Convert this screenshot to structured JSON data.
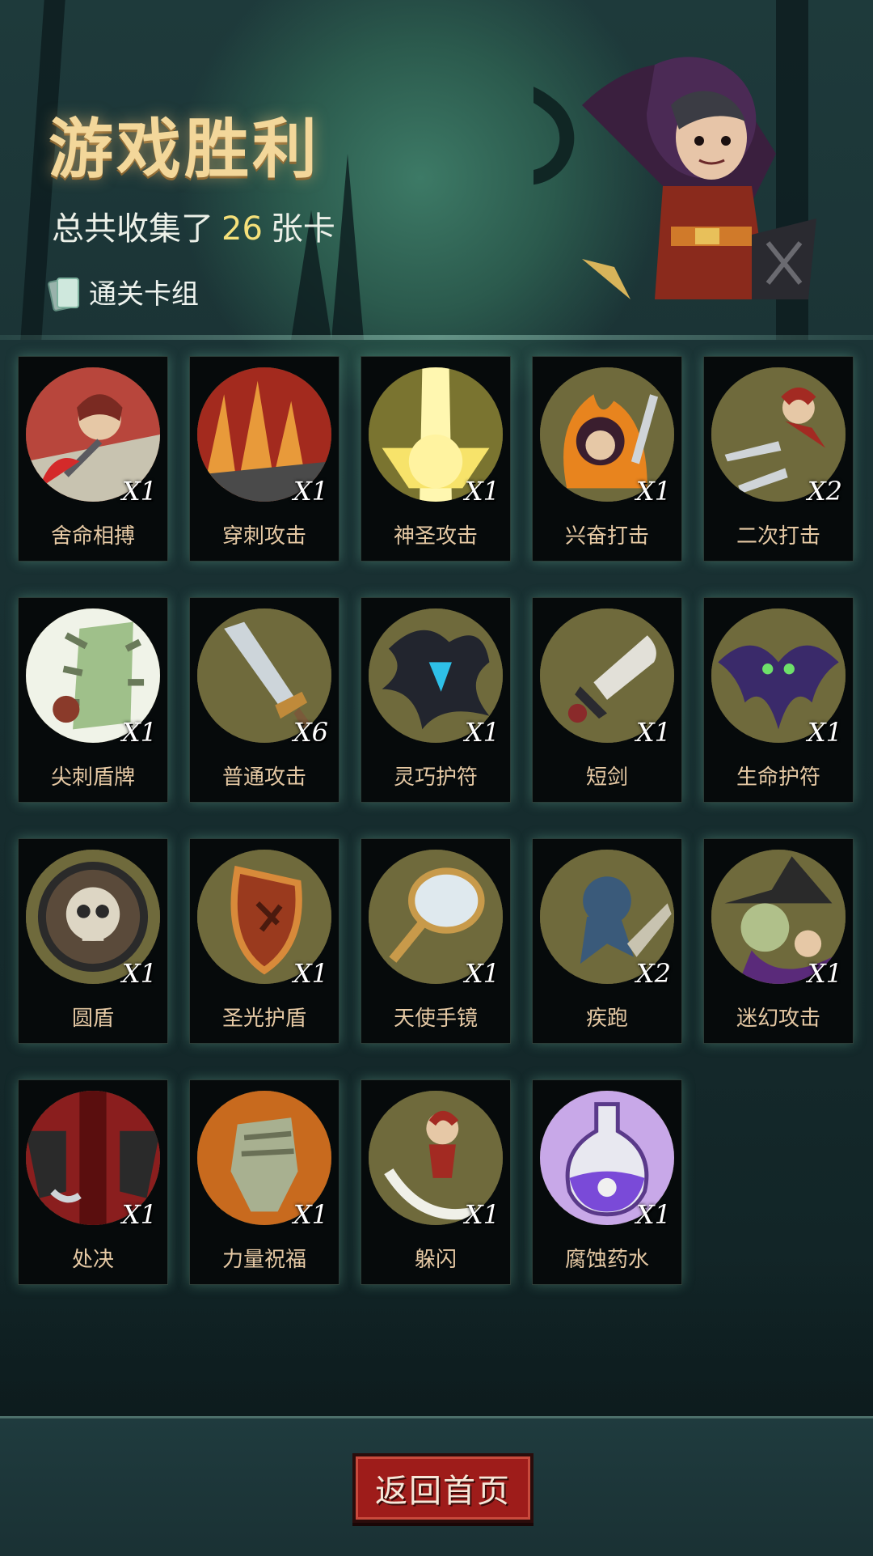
{
  "header": {
    "title": "游戏胜利",
    "summary_prefix": "总共收集了",
    "summary_count": "26",
    "summary_suffix": "张卡",
    "deck_label": "通关卡组"
  },
  "cards": [
    {
      "name": "舍命相搏",
      "count": "X1",
      "icon": "hooded-fighter-icon"
    },
    {
      "name": "穿刺攻击",
      "count": "X1",
      "icon": "spikes-icon"
    },
    {
      "name": "神圣攻击",
      "count": "X1",
      "icon": "holy-light-icon"
    },
    {
      "name": "兴奋打击",
      "count": "X1",
      "icon": "flaming-hero-icon"
    },
    {
      "name": "二次打击",
      "count": "X2",
      "icon": "double-dagger-icon"
    },
    {
      "name": "尖刺盾牌",
      "count": "X1",
      "icon": "spiked-shield-icon"
    },
    {
      "name": "普通攻击",
      "count": "X6",
      "icon": "sword-icon"
    },
    {
      "name": "灵巧护符",
      "count": "X1",
      "icon": "blue-amulet-icon"
    },
    {
      "name": "短剑",
      "count": "X1",
      "icon": "short-sword-icon"
    },
    {
      "name": "生命护符",
      "count": "X1",
      "icon": "bat-amulet-icon"
    },
    {
      "name": "圆盾",
      "count": "X1",
      "icon": "skull-round-shield-icon"
    },
    {
      "name": "圣光护盾",
      "count": "X1",
      "icon": "wooden-shield-icon"
    },
    {
      "name": "天使手镜",
      "count": "X1",
      "icon": "hand-mirror-icon"
    },
    {
      "name": "疾跑",
      "count": "X2",
      "icon": "running-beast-icon"
    },
    {
      "name": "迷幻攻击",
      "count": "X1",
      "icon": "witch-icon"
    },
    {
      "name": "处决",
      "count": "X1",
      "icon": "executioner-icon"
    },
    {
      "name": "力量祝福",
      "count": "X1",
      "icon": "fist-icon"
    },
    {
      "name": "躲闪",
      "count": "X1",
      "icon": "dodge-icon"
    },
    {
      "name": "腐蚀药水",
      "count": "X1",
      "icon": "potion-icon"
    }
  ],
  "footer": {
    "home_button": "返回首页"
  },
  "colors": {
    "title": "#f3d79a",
    "count_highlight": "#f5e07a",
    "card_name": "#e6c9a4",
    "button": "#9e1c1a"
  }
}
